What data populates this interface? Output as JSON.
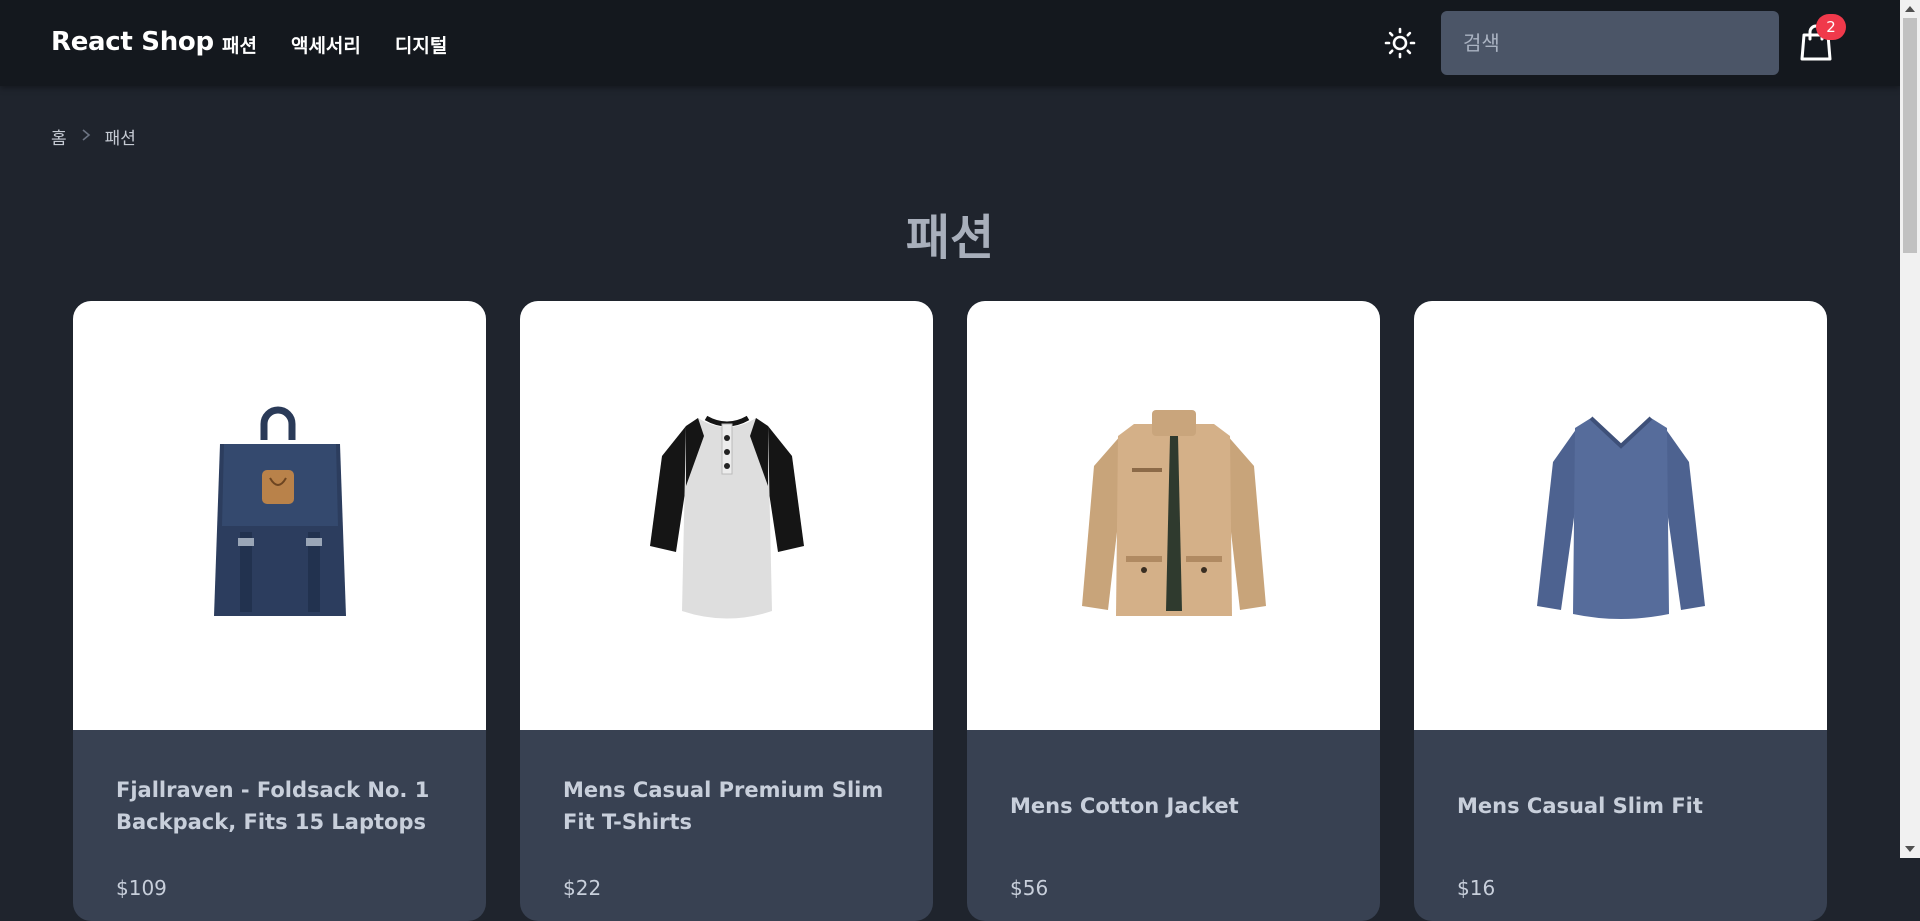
{
  "header": {
    "brand": "React Shop",
    "nav": [
      {
        "label": "패션"
      },
      {
        "label": "액세서리"
      },
      {
        "label": "디지털"
      }
    ],
    "search_placeholder": "검색",
    "cart_count": "2",
    "theme_icon": "sun-icon",
    "cart_icon": "shopping-bag-icon"
  },
  "breadcrumb": {
    "home": "홈",
    "current": "패션",
    "separator_icon": "chevron-right-icon"
  },
  "page": {
    "title": "패션"
  },
  "products": [
    {
      "title": "Fjallraven - Foldsack No. 1 Backpack, Fits 15 Laptops",
      "price": "$109",
      "image": "navy-backpack"
    },
    {
      "title": "Mens Casual Premium Slim Fit T-Shirts",
      "price": "$22",
      "image": "raglan-henley-shirt"
    },
    {
      "title": "Mens Cotton Jacket",
      "price": "$56",
      "image": "khaki-jacket"
    },
    {
      "title": "Mens Casual Slim Fit",
      "price": "$16",
      "image": "blue-long-sleeve-shirt"
    }
  ],
  "colors": {
    "background": "#1f242d",
    "navbar": "#14181e",
    "card_body": "#384152",
    "search_bg": "#4b5567",
    "badge": "#f0394b"
  }
}
